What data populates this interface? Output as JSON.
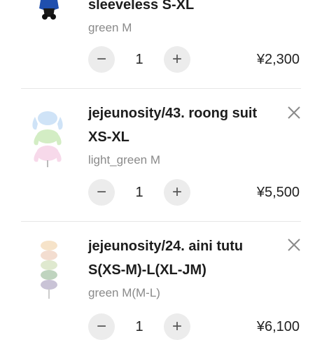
{
  "items": [
    {
      "title": "sleeveless S-XL",
      "variant": "green M",
      "quantity": "1",
      "price": "¥2,300",
      "decrease_icon": "minus-icon",
      "increase_icon": "plus-icon"
    },
    {
      "title": "jejeunosity/43. roong suit XS-XL",
      "variant": "light_green M",
      "quantity": "1",
      "price": "¥5,500",
      "decrease_icon": "minus-icon",
      "increase_icon": "plus-icon",
      "remove_icon": "close-icon"
    },
    {
      "title": "jejeunosity/24. aini tutu S(XS-M)-L(XL-JM)",
      "variant": "green M(M-L)",
      "quantity": "1",
      "price": "¥6,100",
      "decrease_icon": "minus-icon",
      "increase_icon": "plus-icon",
      "remove_icon": "close-icon"
    }
  ],
  "colors": {
    "button_bg": "#ececec",
    "divider": "#e6e6e6",
    "variant_text": "#8a8a8a"
  }
}
